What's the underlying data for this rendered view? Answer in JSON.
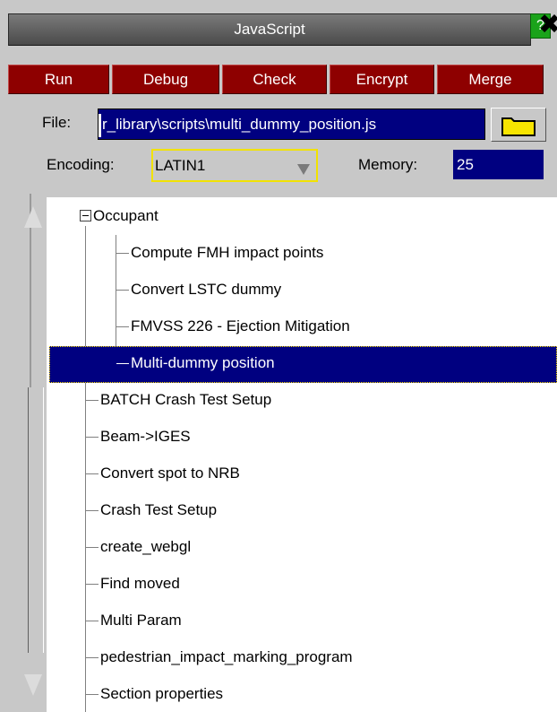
{
  "window": {
    "title": "JavaScript",
    "help_label": "?",
    "close_label": "✖"
  },
  "toolbar": {
    "buttons": [
      "Run",
      "Debug",
      "Check",
      "Encrypt",
      "Merge"
    ]
  },
  "file": {
    "label": "File:",
    "value": "r_library\\scripts\\multi_dummy_position.js"
  },
  "encoding": {
    "label": "Encoding:",
    "value": "LATIN1"
  },
  "memory": {
    "label": "Memory:",
    "value": "25"
  },
  "tree": {
    "group": "Occupant",
    "children": [
      "Compute FMH impact points",
      "Convert LSTC dummy",
      "FMVSS 226 - Ejection Mitigation",
      "Multi-dummy position"
    ],
    "selected_index": 3,
    "items": [
      "BATCH Crash Test Setup",
      "Beam->IGES",
      "Convert spot to NRB",
      "Crash Test Setup",
      "create_webgl",
      "Find moved",
      "Multi Param",
      "pedestrian_impact_marking_program",
      "Section properties"
    ]
  },
  "colors": {
    "button_red": "#8e0000",
    "field_blue": "#000080",
    "focus_yellow": "#f2e200",
    "help_green": "#1aa31a"
  },
  "icons": [
    "help-icon",
    "close-icon",
    "folder-icon",
    "dropdown-icon",
    "expand-collapse-icon",
    "scroll-up-icon",
    "scroll-down-icon"
  ]
}
